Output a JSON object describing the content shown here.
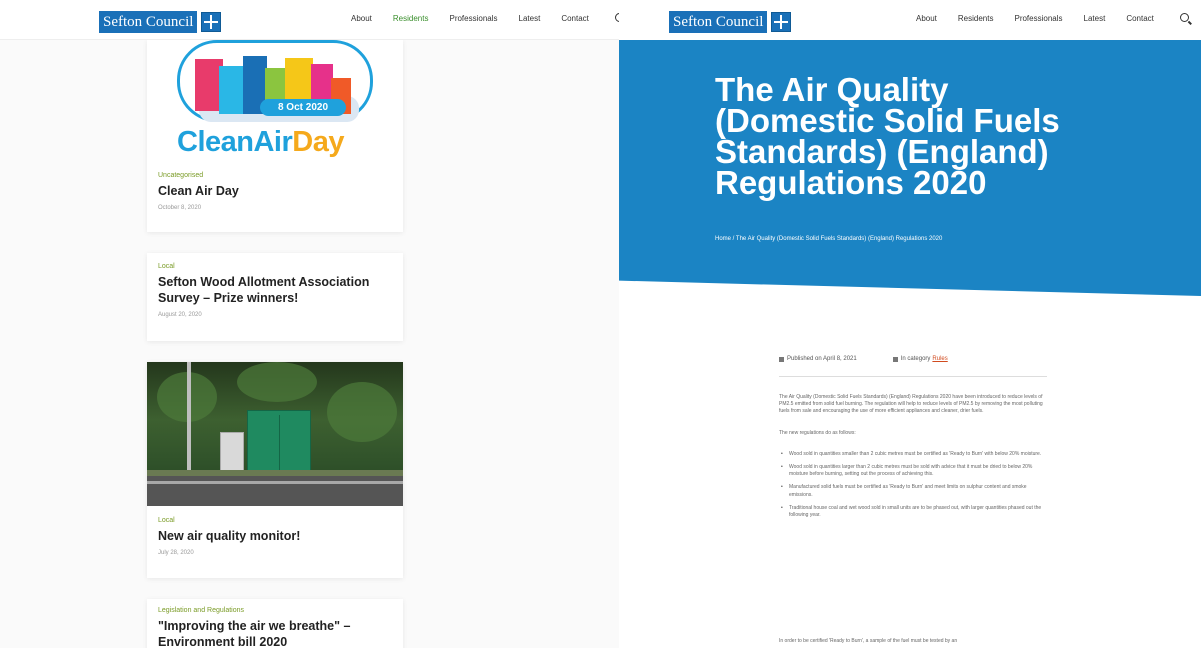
{
  "left": {
    "logo": "Sefton Council",
    "nav": [
      "About",
      "Residents",
      "Professionals",
      "Latest",
      "Contact"
    ],
    "cards": [
      {
        "category": "Uncategorised",
        "title": "Clean Air Day",
        "date": "October 8, 2020",
        "image": {
          "date": "8 Oct 2020",
          "wordmark_1": "CleanAir",
          "wordmark_2": "Day"
        }
      },
      {
        "category": "Local",
        "title": "Sefton Wood Allotment Association Survey – Prize winners!",
        "date": "August 20, 2020"
      },
      {
        "category": "Local",
        "title": "New air quality monitor!",
        "date": "July 28, 2020"
      },
      {
        "category": "Legislation and Regulations",
        "title": "\"Improving the air we breathe\" – Environment bill 2020"
      }
    ]
  },
  "right": {
    "logo": "Sefton Council",
    "nav": [
      "About",
      "Residents",
      "Professionals",
      "Latest",
      "Contact"
    ],
    "hero_title": "The Air Quality\n(Domestic Solid Fuels\nStandards) (England)\nRegulations 2020",
    "breadcrumb": "Home / The Air Quality (Domestic Solid Fuels Standards) (England) Regulations 2020",
    "meta": {
      "published": "Published on April 8, 2021",
      "category_label": "In category",
      "category": "Rules"
    },
    "intro": "The Air Quality (Domestic Solid Fuels Standards) (England) Regulations 2020 have been introduced to reduce levels of PM2.5 emitted from solid fuel burning. The regulation will help to reduce levels of PM2.5 by removing the most polluting fuels from sale and encouraging the use of more efficient appliances and cleaner, drier fuels.",
    "list_intro": "The new regulations do as follows:",
    "bullets": [
      "Wood sold in quantities smaller than 2 cubic metres must be certified as 'Ready to Burn' with below 20% moisture.",
      "Wood sold in quantities larger than 2 cubic metres must be sold with advice that it must be dried to below 20% moisture before burning, setting out the process of achieving this.",
      "Manufactured solid fuels must be certified as 'Ready to Burn' and meet limits on sulphur content and smoke emissions.",
      "Traditional house coal and wet wood sold in small units are to be phased out, with larger quantities phased out the following year."
    ],
    "footer": "In order to be certified 'Ready to Burn', a sample of the fuel must be tested by an"
  }
}
